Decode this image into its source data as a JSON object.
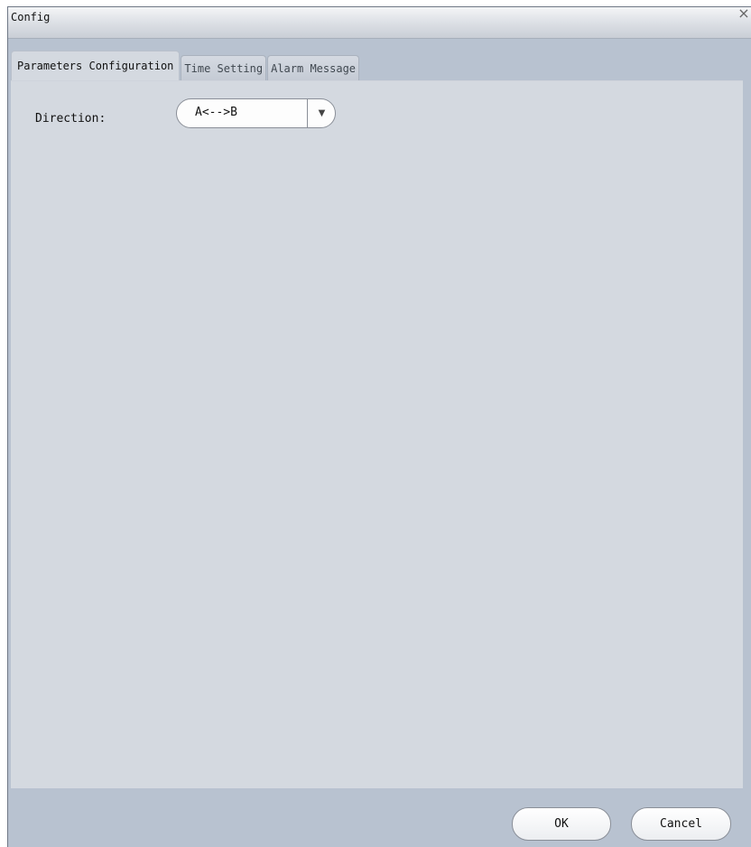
{
  "window": {
    "title": "Config",
    "close_glyph": "×"
  },
  "tabs": [
    {
      "label": "Parameters Configuration",
      "active": true
    },
    {
      "label": "Time Setting",
      "active": false
    },
    {
      "label": "Alarm Message",
      "active": false
    }
  ],
  "form": {
    "direction_label": "Direction:",
    "direction_value": "A<-->B",
    "dropdown_arrow": "▼"
  },
  "footer": {
    "ok_label": "OK",
    "cancel_label": "Cancel"
  },
  "colors": {
    "window_frame": "#b8c2d0",
    "content_bg": "#d4d9e0",
    "button_bg": "#ffffff"
  }
}
